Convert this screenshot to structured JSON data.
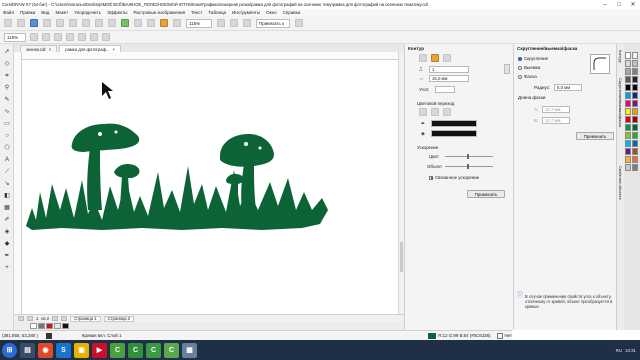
{
  "title_bar": {
    "text": "CorelDRAW X7 (64 бит) - C:\\Users\\Наталья\\Desktop\\МОЁ ВСЁ\\ВАЖНОЕ_ПОЛЕЗНОЕ\\МОЙ ЮТУБ\\КомпГрафика\\лазерная резка\\рамка для фотографий на осеннюю тему\\рамка для фотографий на осеннюю тематику.cdr",
    "minimize": "–",
    "maximize": "□",
    "close": "✕"
  },
  "menu": [
    "Файл",
    "Правка",
    "Вид",
    "Макет",
    "Упорядочить",
    "Эффекты",
    "Растровые изображения",
    "Текст",
    "Таблица",
    "Инструменты",
    "Окно",
    "Справка"
  ],
  "toolbar": {
    "zoom_value": "115%",
    "snap_label": "Привязать к",
    "zoom_left": "115%"
  },
  "doc_tabs": [
    {
      "label": "значок.cdr",
      "active": false
    },
    {
      "label": "рамка для фотограф...",
      "active": true
    }
  ],
  "pages": {
    "current": "1",
    "of_label": "из 2",
    "tabs": [
      "Страница 1",
      "Страница 2"
    ]
  },
  "status": {
    "coords": "(381,855; 53,280 )",
    "layer_info": "Кривая вкл. Слой 1",
    "fill_info": "R:12 G:99 B:54 (#0C6336)",
    "outline_info": "Нет"
  },
  "contour_panel": {
    "title": "Контур",
    "steps": "1",
    "offset": "15,0 мм",
    "corners_label": "Угол:",
    "color_transition": "Цветовой переход",
    "acceleration_title": "Ускорение",
    "color_label": "Цвет",
    "object_label": "Объект",
    "linked_accel": "Связанное ускорение",
    "apply_button": "Применить"
  },
  "fillet_panel": {
    "title": "Скругление/выемка/фаска",
    "options": [
      "Скругление",
      "Выемка",
      "Фаска"
    ],
    "radius_label": "Радиус:",
    "radius_value": "5,0 мм",
    "chamfer_length": "Длина фаски",
    "a_label": "A:",
    "a_value": "12,7 мм",
    "b_label": "B:",
    "b_value": "12,7 мм",
    "apply_button": "Применить",
    "info_text": "В случае применения свойств угла к объекту, отличному от кривой, объект преобразуется в кривые."
  },
  "docker_tabs": [
    "Контур",
    "Скругление/выемка/фаска",
    "Свойства объекта"
  ],
  "colors": {
    "mushroom_green": "#0C6336",
    "taskbar": "#1f2f45"
  },
  "taskbar": {
    "time": "10:31",
    "lang": "RU"
  }
}
